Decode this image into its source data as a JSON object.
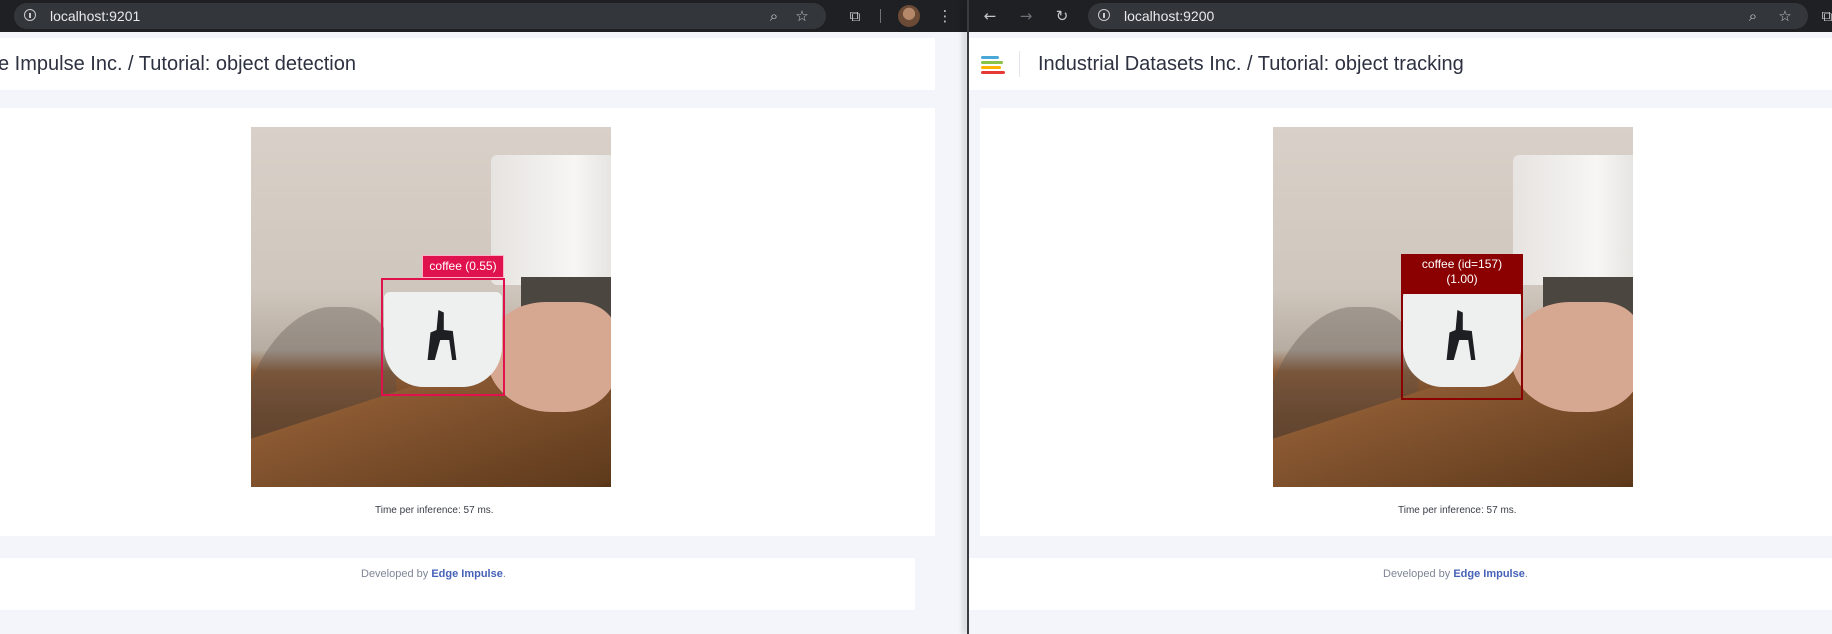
{
  "left_window": {
    "url": "localhost:9201",
    "page_title": "e Impulse Inc. / Tutorial: object detection",
    "detection_label": "coffee (0.55)",
    "detection_color": "#e0124e",
    "inference_text": "Time per inference: 57 ms.",
    "footer_prefix": "Developed by ",
    "footer_link": "Edge Impulse",
    "footer_suffix": "."
  },
  "right_window": {
    "url": "localhost:9200",
    "page_title": "Industrial Datasets Inc. / Tutorial: object tracking",
    "tracking_label_line1": "coffee (id=157)",
    "tracking_label_line2": "(1.00)",
    "tracking_color": "#8b0000",
    "inference_text": "Time per inference: 57 ms.",
    "footer_prefix": "Developed by ",
    "footer_link": "Edge Impulse",
    "footer_suffix": "."
  },
  "icons": {
    "left_chrome": [
      "info-icon",
      "zoom-icon",
      "star-icon",
      "extensions-icon",
      "avatar",
      "more-icon"
    ],
    "right_chrome": [
      "back-icon",
      "forward-icon",
      "reload-icon",
      "info-icon",
      "zoom-icon",
      "star-icon",
      "extensions-icon"
    ]
  }
}
